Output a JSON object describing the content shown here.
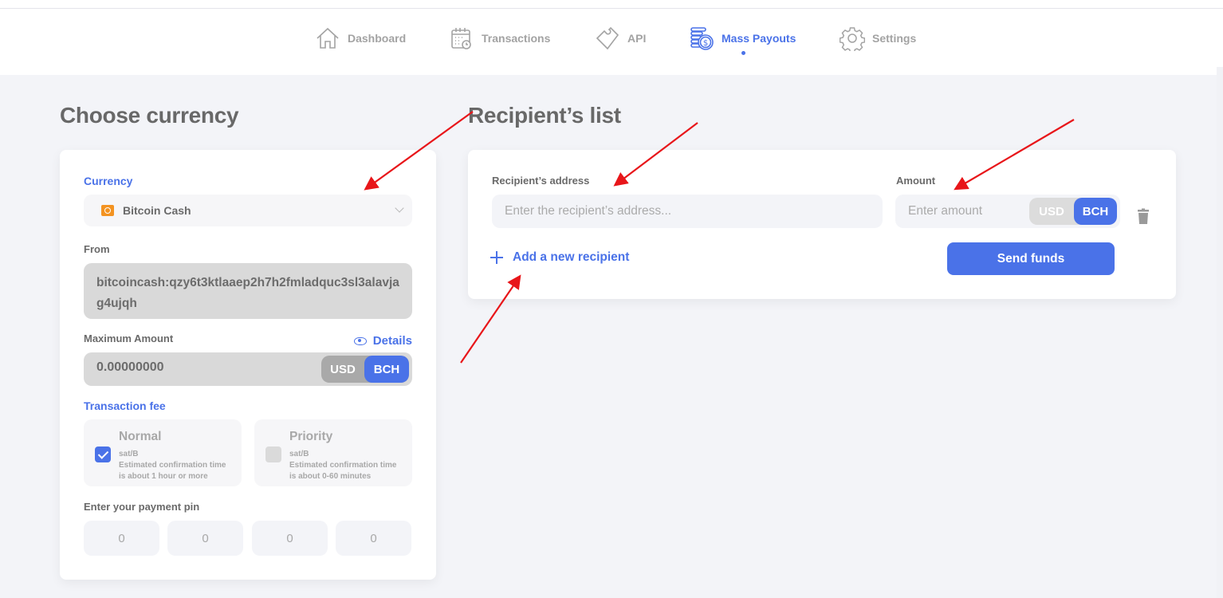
{
  "nav": {
    "items": [
      {
        "label": "Dashboard",
        "icon": "home-icon",
        "active": false
      },
      {
        "label": "Transactions",
        "icon": "calendar-clock-icon",
        "active": false
      },
      {
        "label": "API",
        "icon": "puzzle-icon",
        "active": false
      },
      {
        "label": "Mass Payouts",
        "icon": "coins-stack-icon",
        "active": true
      },
      {
        "label": "Settings",
        "icon": "gear-icon",
        "active": false
      }
    ],
    "accent_color": "#4a72e8"
  },
  "left": {
    "title": "Choose currency",
    "currency_label": "Currency",
    "currency_value": "Bitcoin Cash",
    "currency_icon": "bitcoin-cash-icon",
    "from_label": "From",
    "from_value": "bitcoincash:qzy6t3ktlaaep2h7h2fmladquc3sl3alavjag4ujqh",
    "max_amount_label": "Maximum Amount",
    "details_label": "Details",
    "max_amount_value": "0.00000000",
    "toggle": {
      "usd": "USD",
      "bch": "BCH",
      "selected": "BCH"
    },
    "fee_label": "Transaction fee",
    "fees": [
      {
        "title": "Normal",
        "unit": "sat/B",
        "desc1": "Estimated confirmation time",
        "desc2": "is about 1 hour or more",
        "checked": true
      },
      {
        "title": "Priority",
        "unit": "sat/B",
        "desc1": "Estimated confirmation time",
        "desc2": "is about 0-60 minutes",
        "checked": false
      }
    ],
    "pin_label": "Enter your payment pin",
    "pin_values": [
      "0",
      "0",
      "0",
      "0"
    ]
  },
  "right": {
    "title": "Recipient’s list",
    "address_label": "Recipient’s address",
    "address_placeholder": "Enter the recipient’s address...",
    "amount_label": "Amount",
    "amount_placeholder": "Enter amount",
    "toggle": {
      "usd": "USD",
      "bch": "BCH",
      "selected": "BCH"
    },
    "add_label": "Add a new recipient",
    "send_label": "Send funds"
  }
}
